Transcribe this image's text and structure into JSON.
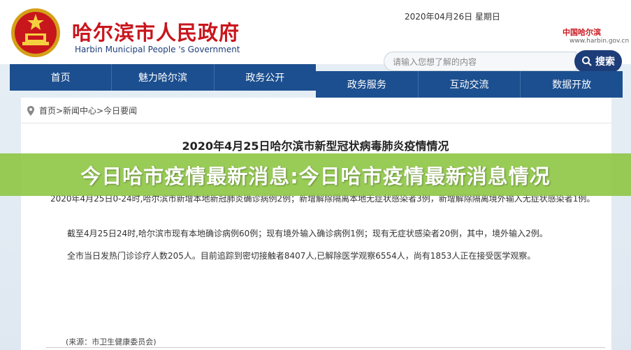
{
  "header": {
    "title_cn": "哈尔滨市人民政府",
    "title_en": "Harbin Municipal People 's Government",
    "date": "2020年04月26日 星期日",
    "city_logo": "中国哈尔滨",
    "city_url": "www.harbin.gov.cn"
  },
  "search": {
    "placeholder": "请输入您想了解的内容",
    "button_label": "搜索",
    "icon": "search-icon"
  },
  "nav": {
    "row1": [
      "首页",
      "魅力哈尔滨",
      "政务公开"
    ],
    "row2": [
      "政务服务",
      "互动交流",
      "数据开放"
    ]
  },
  "breadcrumb": "首页>新闻中心>今日要闻",
  "article": {
    "title": "2020年4月25日哈尔滨市新型冠状病毒肺炎疫情情况",
    "p1": "2020年4月25日0-24时,哈尔滨市新增本地新冠肺炎确诊病例2例；新增解除隔离本地无症状感染者3例，新增解除隔离境外输入无症状感染者1例。",
    "p2": "截至4月25日24时,哈尔滨市现有本地确诊病例60例；现有境外输入确诊病例1例；现有无症状感染者20例，其中，境外输入2例。",
    "p3": "全市当日发热门诊诊疗人数205人。目前追踪到密切接触者8407人,已解除医学观察6554人，尚有1853人正在接受医学观察。",
    "source": "(来源：市卫生健康委员会)"
  },
  "banner": {
    "text": "今日哈市疫情最新消息:今日哈市疫情最新消息情况",
    "color": "#8bc53f"
  },
  "colors": {
    "nav": "#1c4f8f",
    "brand_red": "#c8161d",
    "search_button": "#1d3d78"
  }
}
